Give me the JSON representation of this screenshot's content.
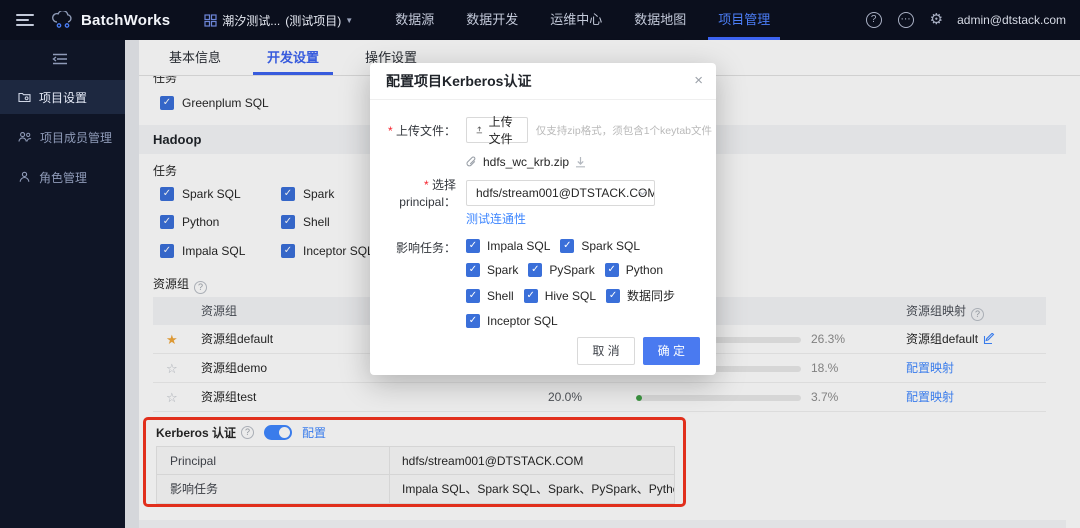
{
  "topnav": {
    "brand": "BatchWorks",
    "project": {
      "name": "潮汐测试...",
      "suffix": "(测试项目)"
    },
    "items": [
      {
        "label": "数据源",
        "active": false
      },
      {
        "label": "数据开发",
        "active": false
      },
      {
        "label": "运维中心",
        "active": false
      },
      {
        "label": "数据地图",
        "active": false
      },
      {
        "label": "项目管理",
        "active": true
      }
    ],
    "help_icon": "?",
    "message_icon": "⋯",
    "gear_icon": "⚙",
    "user_email": "admin@dtstack.com"
  },
  "sidebar": {
    "items": [
      {
        "label": "项目设置",
        "active": true
      },
      {
        "label": "项目成员管理",
        "active": false
      },
      {
        "label": "角色管理",
        "active": false
      }
    ]
  },
  "tabs": [
    {
      "label": "基本信息",
      "active": false
    },
    {
      "label": "开发设置",
      "active": true
    },
    {
      "label": "操作设置",
      "active": false
    }
  ],
  "content": {
    "clipped_label": "任务",
    "greenplum_checkbox": "Greenplum SQL",
    "hadoop_section": "Hadoop",
    "task_label": "任务",
    "task_checkboxes": [
      "Spark SQL",
      "Spark",
      "Python",
      "Shell",
      "Impala SQL",
      "Inceptor SQL"
    ],
    "resource_group": {
      "title": "资源组",
      "col_name": "资源组",
      "col_mapping": "资源组映射",
      "rows": [
        {
          "name": "资源组default",
          "starred": true,
          "quota": "",
          "percent": "26.3%",
          "mapping": "资源组default",
          "mapping_is_link": false
        },
        {
          "name": "资源组demo",
          "starred": false,
          "quota": "",
          "percent": "18.%",
          "mapping": "配置映射",
          "mapping_is_link": true
        },
        {
          "name": "资源组test",
          "starred": false,
          "quota": "20.0%",
          "percent": "3.7%",
          "mapping": "配置映射",
          "mapping_is_link": true
        }
      ]
    },
    "kerberos": {
      "title": "Kerberos 认证",
      "toggle_on": true,
      "config_link": "配置",
      "rows": [
        {
          "label": "Principal",
          "value": "hdfs/stream001@DTSTACK.COM"
        },
        {
          "label": "影响任务",
          "value": "Impala SQL、Spark SQL、Spark、PySpark、Python、Shell、Hive SQL、数据同步、Inceptor SQL"
        }
      ]
    }
  },
  "modal": {
    "title": "配置项目Kerberos认证",
    "close_icon": "×",
    "upload_label": "上传文件：",
    "upload_button": "上传文件",
    "upload_hint": "仅支持zip格式，须包含1个keytab文件",
    "file_name": "hdfs_wc_krb.zip",
    "principal_label": "选择principal：",
    "principal_value": "hdfs/stream001@DTSTACK.COM",
    "test_link": "测试连通性",
    "tasks_label": "影响任务：",
    "task_options": [
      "Impala SQL",
      "Spark SQL",
      "Spark",
      "PySpark",
      "Python",
      "Shell",
      "Hive SQL",
      "数据同步",
      "Inceptor SQL"
    ],
    "cancel_label": "取 消",
    "ok_label": "确 定"
  },
  "colors": {
    "primary_blue": "#4a7af0",
    "link_blue": "#3f87ff",
    "nav_active_blue": "#3c63f0",
    "checkbox_blue": "#3a6fd9",
    "highlight_red": "#f5341f",
    "star_gold": "#f0a73a",
    "progress_green": "#3fa045",
    "topnav_bg": "#0b0f1d",
    "sidebar_bg": "#0f1526"
  }
}
